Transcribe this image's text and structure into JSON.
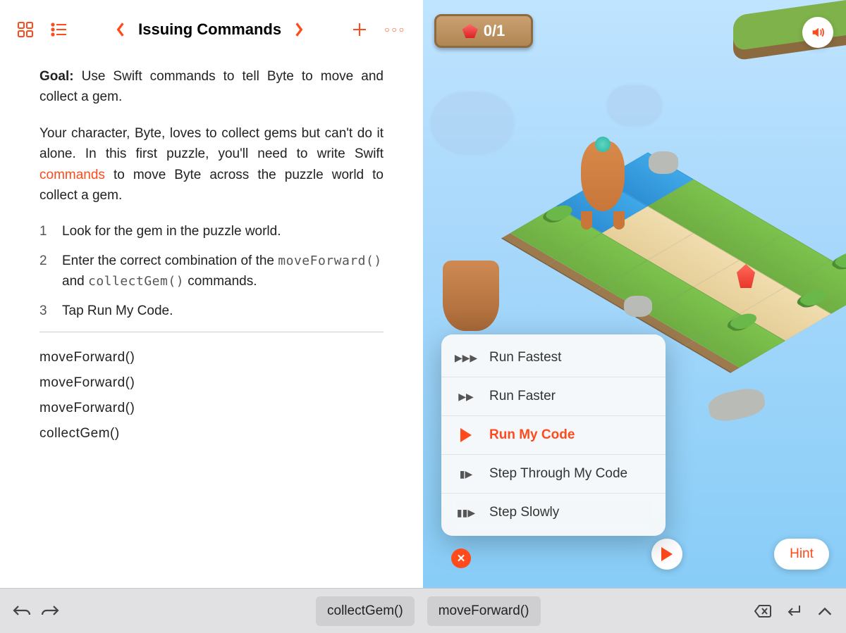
{
  "header": {
    "title": "Issuing Commands"
  },
  "lesson": {
    "goal_label": "Goal:",
    "goal_text": " Use Swift commands to tell Byte to move and collect a gem.",
    "intro_a": "Your character, Byte, loves to collect gems but can't do it alone. In this first puzzle, you'll need to write Swift ",
    "intro_link": "commands",
    "intro_b": " to move Byte across the puzzle world to collect a gem.",
    "steps": {
      "s1": "Look for the gem in the puzzle world.",
      "s2a": "Enter the correct combination of the ",
      "s2_code1": "moveForward()",
      "s2_mid": " and ",
      "s2_code2": "collectGem()",
      "s2b": " commands.",
      "s3": "Tap Run My Code."
    }
  },
  "code": {
    "l1": "moveForward()",
    "l2": "moveForward()",
    "l3": "moveForward()",
    "l4": "collectGem()"
  },
  "world": {
    "gem_counter": "0/1",
    "hint_label": "Hint"
  },
  "run_menu": {
    "items": {
      "fastest": "Run Fastest",
      "faster": "Run Faster",
      "run": "Run My Code",
      "step": "Step Through My Code",
      "slow": "Step Slowly"
    },
    "active": "run"
  },
  "suggestions": {
    "a": "collectGem()",
    "b": "moveForward()"
  }
}
